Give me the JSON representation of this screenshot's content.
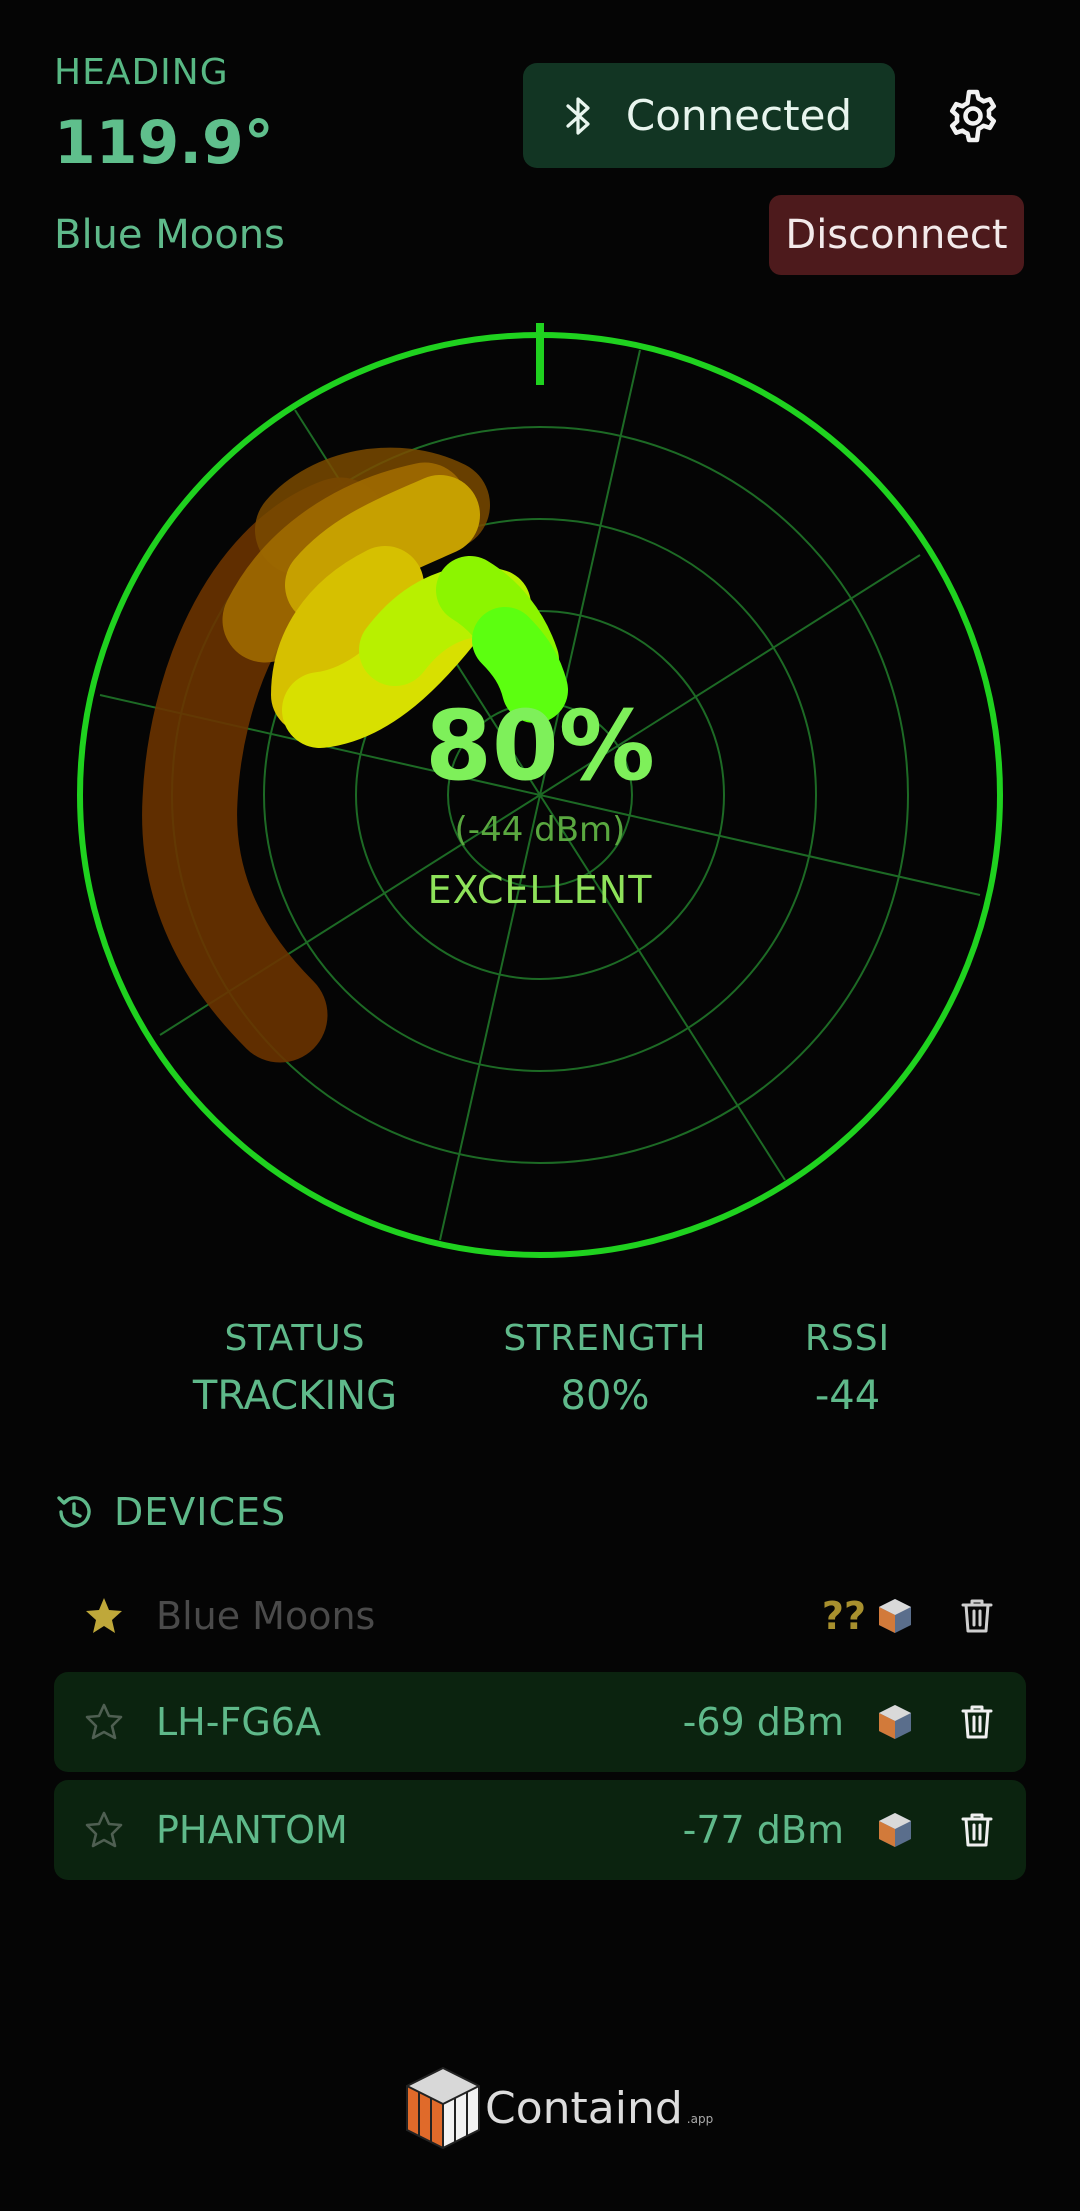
{
  "header": {
    "heading_label": "HEADING",
    "heading_value": "119.9°",
    "device_name": "Blue Moons",
    "connection_status": "Connected",
    "disconnect_label": "Disconnect"
  },
  "radar": {
    "percent": "80%",
    "dbm": "(-44 dBm)",
    "quality": "EXCELLENT"
  },
  "stats": {
    "status_label": "STATUS",
    "status_value": "TRACKING",
    "strength_label": "STRENGTH",
    "strength_value": "80%",
    "rssi_label": "RSSI",
    "rssi_value": "-44"
  },
  "devices": {
    "title": "DEVICES",
    "items": [
      {
        "name": "Blue Moons",
        "rssi": "??",
        "favorite": true
      },
      {
        "name": "LH-FG6A",
        "rssi": "-69 dBm",
        "favorite": false
      },
      {
        "name": "PHANTOM",
        "rssi": "-77 dBm",
        "favorite": false
      }
    ]
  },
  "footer": {
    "logo_text": "Containd",
    "logo_suffix": ".app"
  },
  "colors": {
    "accent_green": "#5fb98a",
    "radar_green": "#1fd21f",
    "connected_bg": "#123523",
    "disconnect_bg": "#4d1a1c"
  }
}
